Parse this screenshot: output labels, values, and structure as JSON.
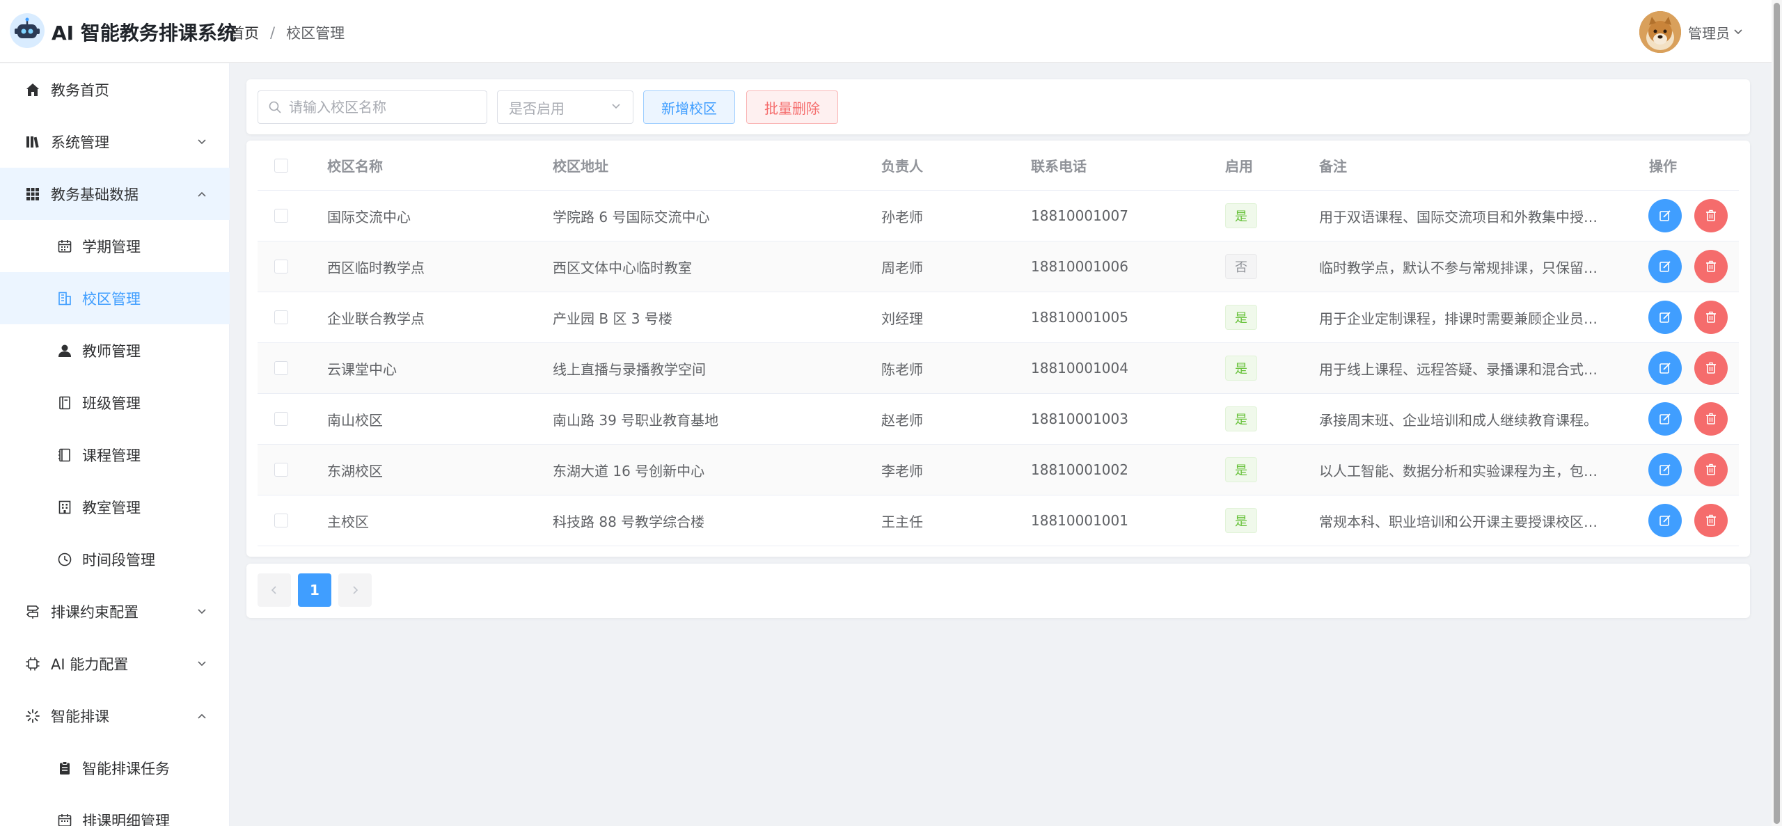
{
  "app": {
    "title": "AI 智能教务排课系统"
  },
  "breadcrumb": {
    "home": "首页",
    "separator": "/",
    "current": "校区管理"
  },
  "user": {
    "name": "管理员"
  },
  "sidebar": {
    "items": [
      {
        "label": "教务首页",
        "icon": "home-icon"
      },
      {
        "label": "系统管理",
        "icon": "library-icon",
        "arrow": "down"
      },
      {
        "label": "教务基础数据",
        "icon": "grid-icon",
        "arrow": "up"
      },
      {
        "label": "学期管理",
        "icon": "calendar-icon"
      },
      {
        "label": "校区管理",
        "icon": "building-icon"
      },
      {
        "label": "教师管理",
        "icon": "user-icon"
      },
      {
        "label": "班级管理",
        "icon": "notebook-icon"
      },
      {
        "label": "课程管理",
        "icon": "book-icon"
      },
      {
        "label": "教室管理",
        "icon": "office-building-icon"
      },
      {
        "label": "时间段管理",
        "icon": "clock-icon"
      },
      {
        "label": "排课约束配置",
        "icon": "guide-icon",
        "arrow": "down"
      },
      {
        "label": "AI 能力配置",
        "icon": "cpu-icon",
        "arrow": "down"
      },
      {
        "label": "智能排课",
        "icon": "loading-icon",
        "arrow": "up"
      },
      {
        "label": "智能排课任务",
        "icon": "clipboard-icon"
      },
      {
        "label": "排课明细管理",
        "icon": "calendar-icon"
      }
    ]
  },
  "toolbar": {
    "search_placeholder": "请输入校区名称",
    "enabled_placeholder": "是否启用",
    "add_label": "新增校区",
    "batch_delete_label": "批量删除"
  },
  "table": {
    "columns": [
      "校区名称",
      "校区地址",
      "负责人",
      "联系电话",
      "启用",
      "备注",
      "操作"
    ],
    "rows": [
      {
        "name": "国际交流中心",
        "address": "学院路 6 号国际交流中心",
        "manager": "孙老师",
        "phone": "18810001007",
        "enabled": "是",
        "remark": "用于双语课程、国际交流项目和外教集中授…"
      },
      {
        "name": "西区临时教学点",
        "address": "西区文体中心临时教室",
        "manager": "周老师",
        "phone": "18810001006",
        "enabled": "否",
        "remark": "临时教学点，默认不参与常规排课，只保留…"
      },
      {
        "name": "企业联合教学点",
        "address": "产业园 B 区 3 号楼",
        "manager": "刘经理",
        "phone": "18810001005",
        "enabled": "是",
        "remark": "用于企业定制课程，排课时需要兼顾企业员…"
      },
      {
        "name": "云课堂中心",
        "address": "线上直播与录播教学空间",
        "manager": "陈老师",
        "phone": "18810001004",
        "enabled": "是",
        "remark": "用于线上课程、远程答疑、录播课和混合式…"
      },
      {
        "name": "南山校区",
        "address": "南山路 39 号职业教育基地",
        "manager": "赵老师",
        "phone": "18810001003",
        "enabled": "是",
        "remark": "承接周末班、企业培训和成人继续教育课程。"
      },
      {
        "name": "东湖校区",
        "address": "东湖大道 16 号创新中心",
        "manager": "李老师",
        "phone": "18810001002",
        "enabled": "是",
        "remark": "以人工智能、数据分析和实验课程为主，包…"
      },
      {
        "name": "主校区",
        "address": "科技路 88 号教学综合楼",
        "manager": "王主任",
        "phone": "18810001001",
        "enabled": "是",
        "remark": "常规本科、职业培训和公开课主要授课校区…"
      }
    ]
  },
  "pagination": {
    "current_page": "1"
  },
  "colors": {
    "primary": "#409eff",
    "danger": "#f56c6c",
    "success": "#67c23a"
  }
}
